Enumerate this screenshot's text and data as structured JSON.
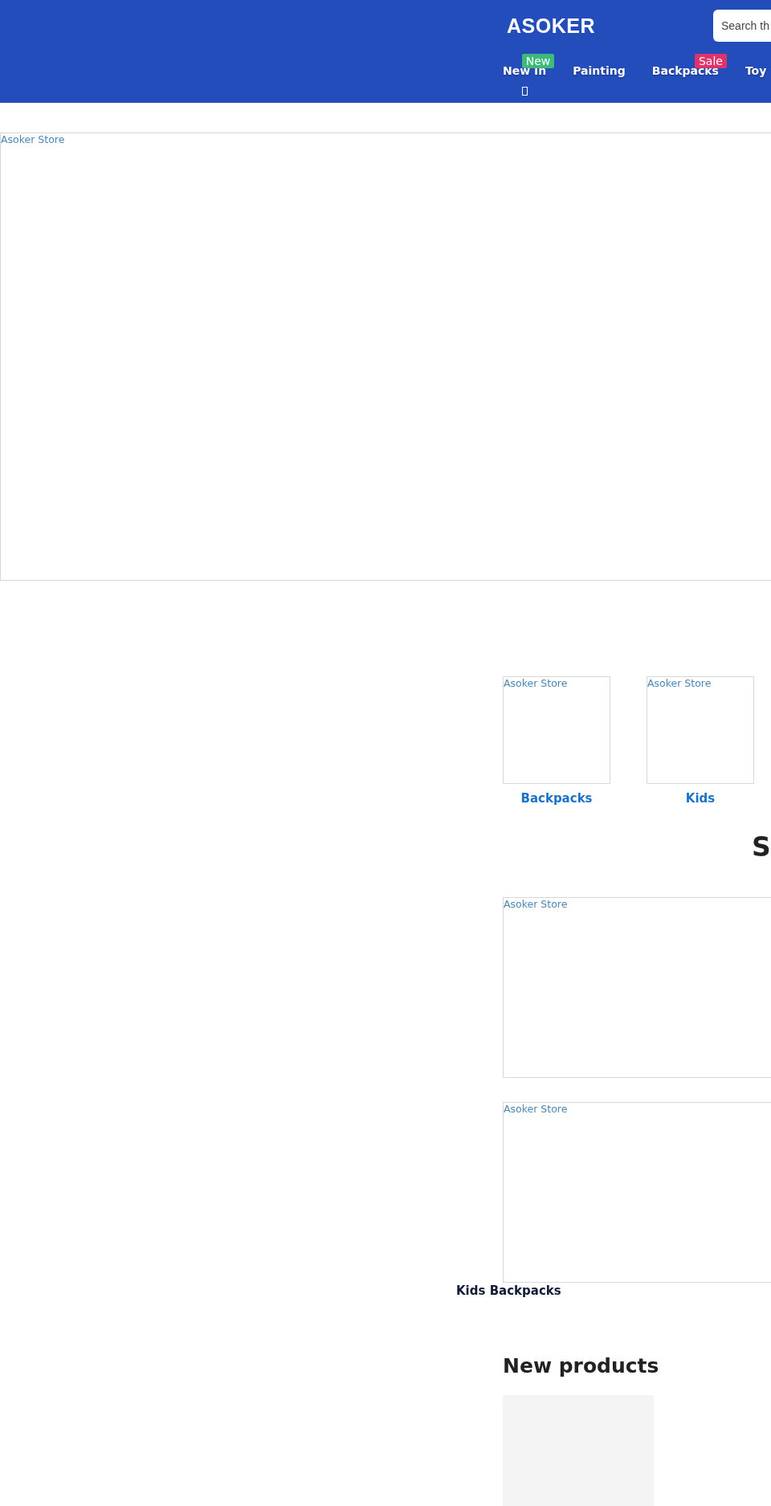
{
  "header": {
    "logo": "ASOKER",
    "search": {
      "placeholder": "Search th"
    },
    "nav": [
      {
        "label": "New In",
        "kind": "dropdown",
        "badge": {
          "text": "New",
          "color": "#3dba7a"
        }
      },
      {
        "label": "Painting",
        "kind": "link"
      },
      {
        "label": "Backpacks",
        "kind": "link",
        "badge": {
          "text": "Sale",
          "color": "#e0336b"
        }
      },
      {
        "label": "Toy",
        "kind": "link"
      }
    ]
  },
  "hero": {
    "alt": "Asoker Store"
  },
  "categories": [
    {
      "alt": "Asoker Store",
      "label": "Backpacks"
    },
    {
      "alt": "Asoker Store",
      "label": "Kids"
    }
  ],
  "section_heading": "S",
  "banners": [
    {
      "alt": "Asoker Store"
    },
    {
      "alt": "Asoker Store"
    }
  ],
  "banner_caption": "Kids Backpacks",
  "new_products": {
    "heading": "New products"
  }
}
